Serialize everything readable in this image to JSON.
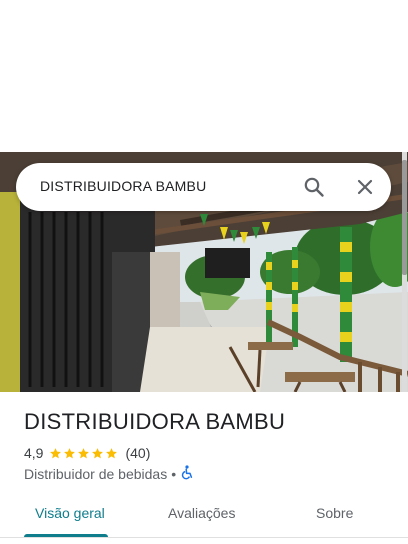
{
  "search": {
    "query": "DISTRIBUIDORA BAMBU"
  },
  "place": {
    "name": "DISTRIBUIDORA BAMBU",
    "rating": "4,9",
    "stars": 5,
    "review_count": "(40)",
    "category": "Distribuidor de bebidas",
    "separator": "•"
  },
  "tabs": [
    {
      "label": "Visão geral",
      "active": true
    },
    {
      "label": "Avaliações",
      "active": false
    },
    {
      "label": "Sobre",
      "active": false
    }
  ],
  "icons": {
    "search": "search-icon",
    "close": "close-icon",
    "accessibility": "wheelchair-accessible-icon",
    "rating": "star-icon"
  },
  "colors": {
    "accent": "#0f7d8c",
    "star": "#fbbc04",
    "accessibility": "#1a73e8",
    "text_primary": "#202124",
    "text_secondary": "#5f6368"
  }
}
